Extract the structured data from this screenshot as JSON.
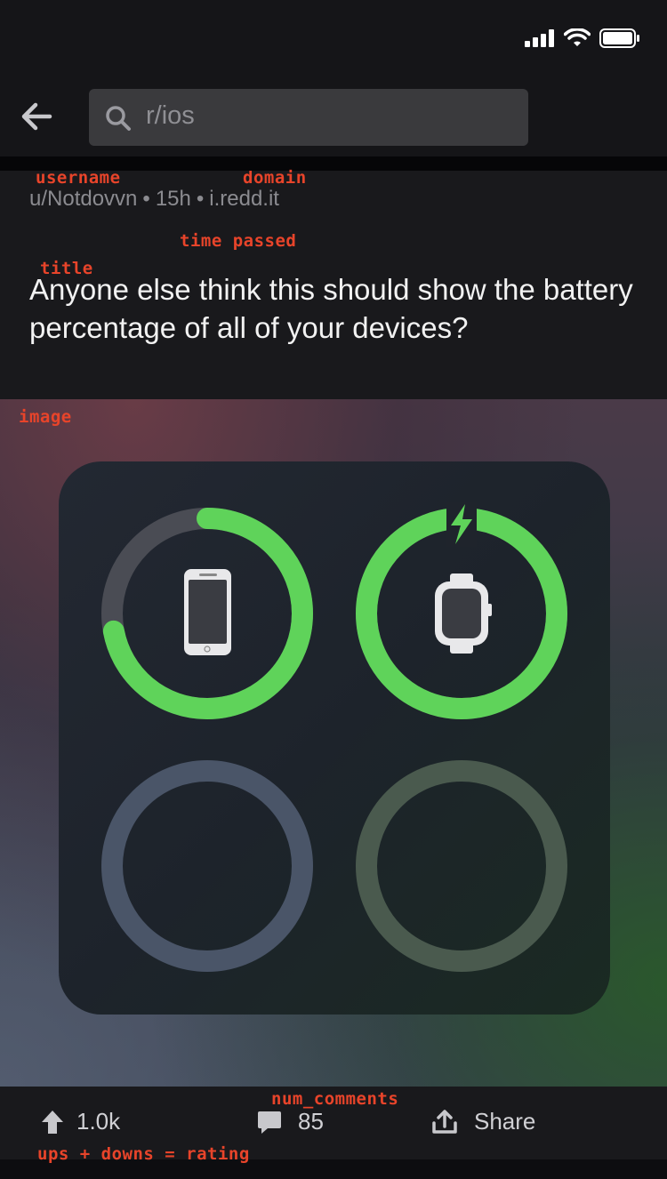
{
  "status_bar": {
    "signal_icon": "cellular-signal-icon",
    "wifi_icon": "wifi-icon",
    "battery_icon": "battery-icon"
  },
  "header": {
    "back_icon": "arrow-left-icon",
    "search": {
      "value": "r/ios",
      "icon": "search-icon"
    }
  },
  "post": {
    "username": "u/Notdovvn",
    "separator": "•",
    "time_passed": "15h",
    "domain": "i.redd.it",
    "title": "Anyone else think this should show the battery percentage of all of your devices?",
    "image": {
      "devices": [
        {
          "icon": "iphone-icon",
          "battery_level": 0.72,
          "charging": false
        },
        {
          "icon": "apple-watch-icon",
          "battery_level": 1.0,
          "charging": true
        },
        {
          "icon": "empty-slot",
          "battery_level": 0,
          "charging": false
        },
        {
          "icon": "empty-slot",
          "battery_level": 0,
          "charging": false
        }
      ],
      "ring_color": "#5fd35a"
    }
  },
  "footer": {
    "ups": "1.0k",
    "num_comments": "85",
    "share_label": "Share"
  },
  "annotations": {
    "username": "username",
    "domain": "domain",
    "time_passed": "time passed",
    "title": "title",
    "image": "image",
    "num_comments": "num_comments",
    "rating": "ups + downs = rating"
  }
}
